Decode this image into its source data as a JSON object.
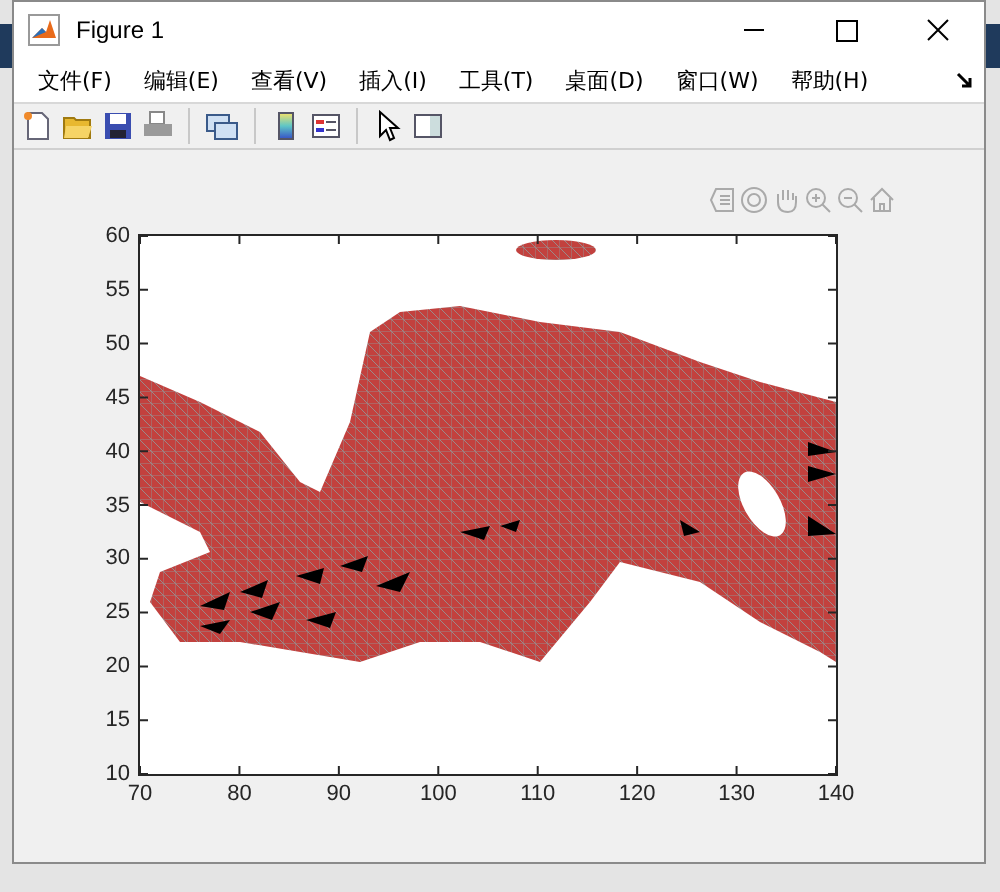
{
  "window": {
    "title": "Figure 1"
  },
  "menus": [
    "文件(F)",
    "编辑(E)",
    "查看(V)",
    "插入(I)",
    "工具(T)",
    "桌面(D)",
    "窗口(W)",
    "帮助(H)"
  ],
  "axes": {
    "xticks": [
      "70",
      "80",
      "90",
      "100",
      "110",
      "120",
      "130",
      "140"
    ],
    "yticks": [
      "60",
      "55",
      "50",
      "45",
      "40",
      "35",
      "30",
      "25",
      "20",
      "15",
      "10"
    ]
  }
}
